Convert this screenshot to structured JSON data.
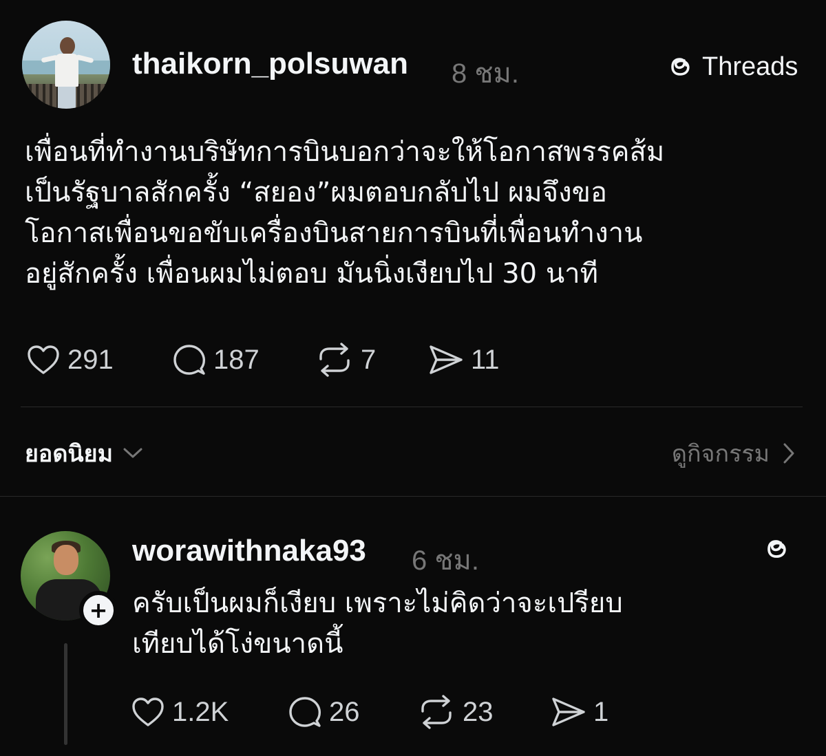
{
  "post": {
    "username": "thaikorn_polsuwan",
    "time": "8 ชม.",
    "brand_label": "Threads",
    "text": "เพื่อนที่ทำงานบริษัทการบินบอกว่าจะให้โอกาสพรรคส้ม\nเป็นรัฐบาลสักครั้ง “สยอง”ผมตอบกลับไป ผมจึงขอ\nโอกาสเพื่อนขอขับเครื่องบินสายการบินที่เพื่อนทำงาน\nอยู่สักครั้ง เพื่อนผมไม่ตอบ มันนิ่งเงียบไป 30 นาที",
    "stats": {
      "likes": "291",
      "comments": "187",
      "reposts": "7",
      "shares": "11"
    }
  },
  "filters": {
    "sort_label": "ยอดนิยม",
    "activity_label": "ดูกิจกรรม"
  },
  "reply": {
    "username": "worawithnaka93",
    "time": "6 ชม.",
    "text": "ครับเป็นผมก็เงียบ เพราะไม่คิดว่าจะเปรียบ\nเทียบได้โง่ขนาดนี้",
    "stats": {
      "likes": "1.2K",
      "comments": "26",
      "reposts": "23",
      "shares": "1"
    }
  },
  "icons": {
    "like": "heart-icon",
    "comment": "comment-bubble-icon",
    "repost": "repost-icon",
    "share": "send-icon",
    "brand": "threads-logo-icon",
    "follow": "plus-icon",
    "sort": "chevron-down-icon",
    "activity": "chevron-right-icon"
  },
  "colors": {
    "background": "#0a0a0a",
    "text": "#f3f5f7",
    "muted": "#777777"
  }
}
